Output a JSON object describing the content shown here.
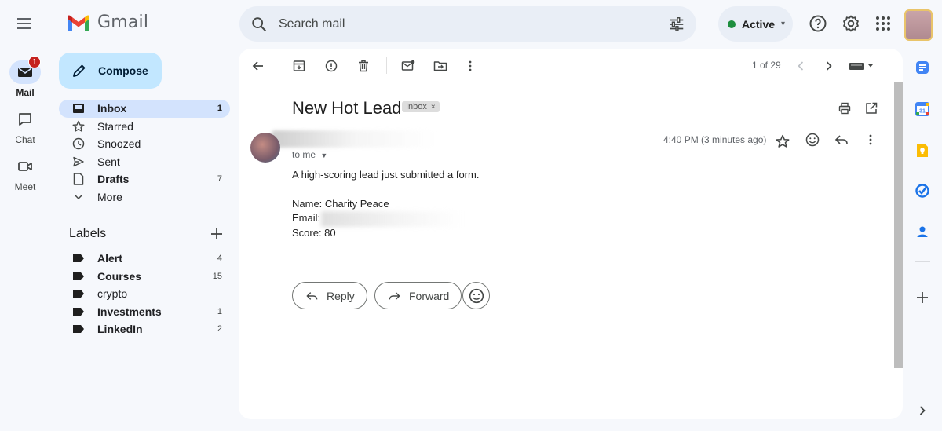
{
  "app": {
    "name": "Gmail"
  },
  "search": {
    "placeholder": "Search mail"
  },
  "status": {
    "label": "Active",
    "color": "#1e8e3e"
  },
  "rail": [
    {
      "label": "Mail",
      "badge": "1",
      "icon": "mail-icon",
      "active": true
    },
    {
      "label": "Chat",
      "icon": "chat-icon"
    },
    {
      "label": "Meet",
      "icon": "video-icon"
    }
  ],
  "compose": {
    "label": "Compose"
  },
  "nav": [
    {
      "label": "Inbox",
      "count": "1",
      "icon": "inbox-icon"
    },
    {
      "label": "Starred",
      "count": "",
      "icon": "star-icon"
    },
    {
      "label": "Snoozed",
      "count": "",
      "icon": "clock-icon"
    },
    {
      "label": "Sent",
      "count": "",
      "icon": "send-icon"
    },
    {
      "label": "Drafts",
      "count": "7",
      "icon": "draft-icon"
    },
    {
      "label": "More",
      "count": "",
      "icon": "chevron-down-icon"
    }
  ],
  "labels": {
    "title": "Labels",
    "items": [
      {
        "label": "Alert",
        "count": "4"
      },
      {
        "label": "Courses",
        "count": "15"
      },
      {
        "label": "crypto",
        "count": ""
      },
      {
        "label": "Investments",
        "count": "1"
      },
      {
        "label": "LinkedIn",
        "count": "2"
      }
    ]
  },
  "toolbar": {
    "pager": "1 of 29"
  },
  "email": {
    "subject": "New Hot Lead",
    "chip": "Inbox",
    "to": "to me",
    "time": "4:40 PM (3 minutes ago)",
    "intro": "A high-scoring lead just submitted a form.",
    "name_line": "Name: Charity Peace",
    "email_line": "Email:",
    "score_line": "Score: 80"
  },
  "actions": {
    "reply": "Reply",
    "forward": "Forward"
  },
  "colors": {
    "accent": "#0b57d0",
    "compose_bg": "#c2e7ff",
    "active_nav": "#d3e3fd",
    "badge": "#c5221f"
  }
}
